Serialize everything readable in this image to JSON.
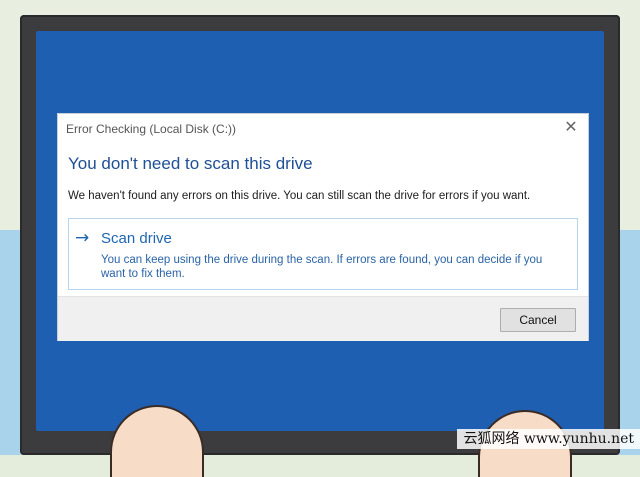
{
  "dialog": {
    "title": "Error Checking (Local Disk (C:))",
    "close_glyph": "✕",
    "heading": "You don't need to scan this drive",
    "description": "We haven't found any errors on this drive. You can still scan the drive for errors if you want.",
    "option": {
      "arrow_glyph": "→",
      "title": "Scan drive",
      "description": "You can keep using the drive during the scan. If errors are found, you can decide if you want to fix them."
    },
    "cancel_label": "Cancel"
  },
  "watermark": "云狐网络 www.yunhu.net",
  "colors": {
    "screen": "#1f5fb1",
    "heading": "#1f4f94",
    "link": "#1e66b2",
    "desk": "#a9d3ea"
  }
}
